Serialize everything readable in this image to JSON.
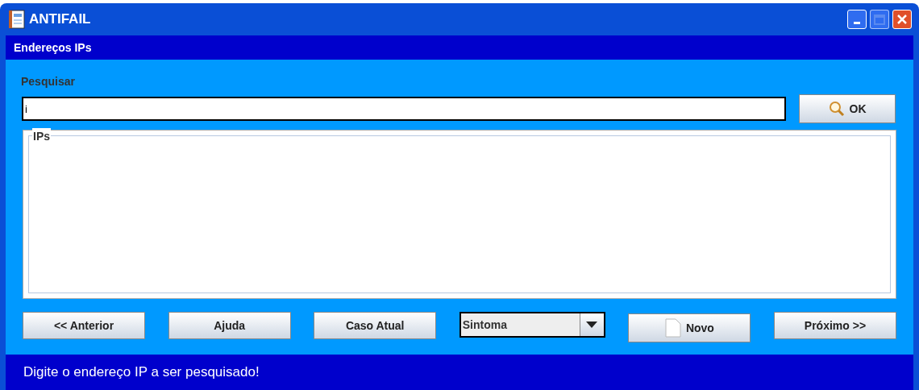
{
  "window": {
    "title": "ANTIFAIL"
  },
  "header": {
    "title": "Endereços IPs"
  },
  "search": {
    "label": "Pesquisar",
    "value": "i",
    "button": "OK"
  },
  "ip_list": {
    "title": "IPs"
  },
  "actions": [
    {
      "kind": "button",
      "label": "<< Anterior"
    },
    {
      "kind": "button",
      "label": "Ajuda"
    },
    {
      "kind": "button",
      "label": "Caso Atual"
    },
    {
      "kind": "dropdown",
      "label": "Sintoma"
    },
    {
      "kind": "new",
      "label": "Novo"
    },
    {
      "kind": "button",
      "label": "Próximo >>"
    }
  ],
  "status_bar": {
    "text": "Digite o endereço IP a ser pesquisado!"
  }
}
